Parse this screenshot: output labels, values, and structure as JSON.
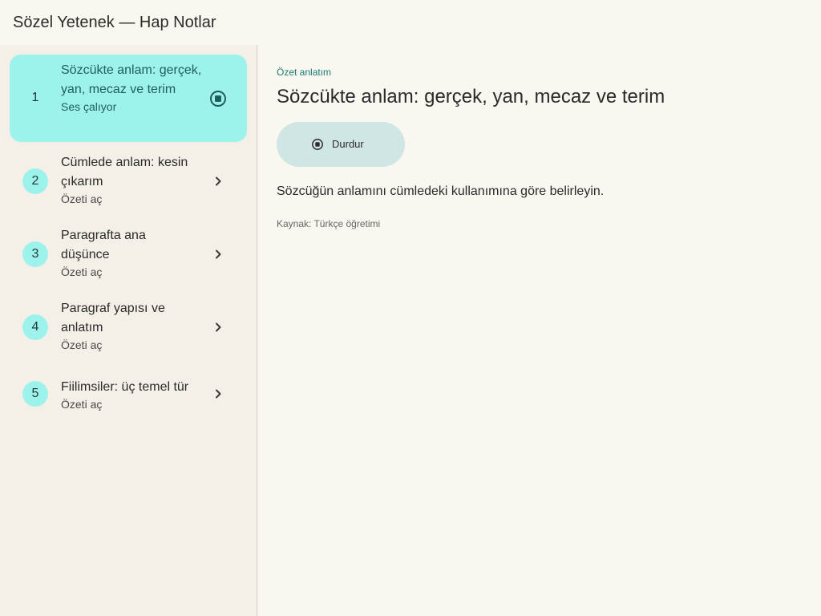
{
  "app": {
    "title": "Sözel Yetenek — Hap Notlar"
  },
  "sidebar": {
    "items": [
      {
        "number": "1",
        "title": "Sözcükte anlam: gerçek, yan, mecaz ve terim",
        "subtitle": "Ses çalıyor",
        "state": "playing",
        "icon": "stop-icon"
      },
      {
        "number": "2",
        "title": "Cümlede anlam: kesin çıkarım",
        "subtitle": "Özeti aç",
        "state": "idle",
        "icon": "chevron-right-icon"
      },
      {
        "number": "3",
        "title": "Paragrafta ana düşünce",
        "subtitle": "Özeti aç",
        "state": "idle",
        "icon": "chevron-right-icon"
      },
      {
        "number": "4",
        "title": "Paragraf yapısı ve anlatım",
        "subtitle": "Özeti aç",
        "state": "idle",
        "icon": "chevron-right-icon"
      },
      {
        "number": "5",
        "title": "Fiilimsiler: üç temel tür",
        "subtitle": "Özeti aç",
        "state": "idle",
        "icon": "chevron-right-icon"
      }
    ]
  },
  "main": {
    "eyebrow": "Özet anlatım",
    "title": "Sözcükte anlam: gerçek, yan, mecaz ve terim",
    "stop_button": {
      "label": "Durdur",
      "icon": "stop-icon"
    },
    "body": "Sözcüğün anlamını cümledeki kullanımına göre belirleyin.",
    "source": "Kaynak: Türkçe öğretimi"
  },
  "colors": {
    "background": "#faf7f1",
    "sidebar_background": "#f4f0e7",
    "accent": "#9ef2ec",
    "accent_text": "#1d5f5a",
    "button_background": "#cfe6e4"
  }
}
